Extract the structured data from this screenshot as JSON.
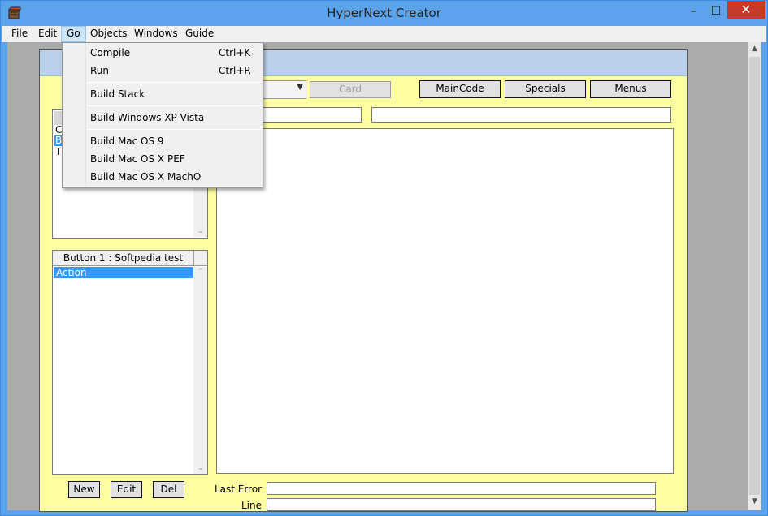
{
  "window": {
    "title": "HyperNext Creator",
    "controls": {
      "minimize": "–",
      "maximize": "☐",
      "close": "✕"
    }
  },
  "menubar": {
    "items": [
      "File",
      "Edit",
      "Go",
      "Objects",
      "Windows",
      "Guide"
    ],
    "active": "Go"
  },
  "go_menu": {
    "compile": {
      "label": "Compile",
      "shortcut": "Ctrl+K"
    },
    "run": {
      "label": "Run",
      "shortcut": "Ctrl+R"
    },
    "build_stack": "Build Stack",
    "build_windows": "Build Windows XP Vista",
    "build_mac9": "Build Mac OS 9",
    "build_macx_pef": "Build Mac OS X PEF",
    "build_macx_macho": "Build Mac OS X MachO"
  },
  "editor": {
    "card_button": "Card",
    "maincode_button": "MainCode",
    "specials_button": "Specials",
    "menus_button": "Menus",
    "object_list_partial": [
      "C",
      "B",
      "T"
    ],
    "handler_header": "Button 1 : Softpedia test",
    "handler_selected": "Action",
    "new_button": "New",
    "edit_button": "Edit",
    "del_button": "Del",
    "last_error_label": "Last Error",
    "line_label": "Line",
    "last_error_value": "",
    "line_value": ""
  },
  "colors": {
    "titlebar": "#5ba3ea",
    "child_background": "#fdfea2",
    "close_button": "#c7392b",
    "selection": "#3399ff"
  }
}
